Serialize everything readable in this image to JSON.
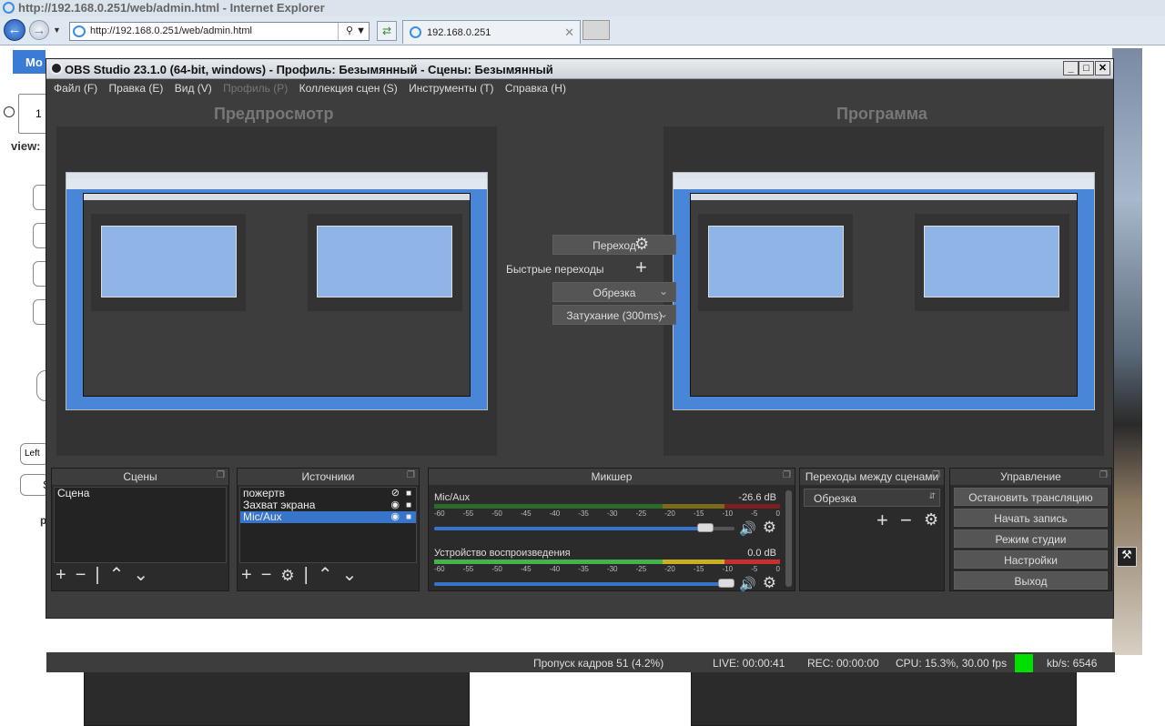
{
  "browser": {
    "window_title": "http://192.168.0.251/web/admin.html - Internet Explorer",
    "address": "http://192.168.0.251/web/admin.html",
    "tab_title": "192.168.0.251"
  },
  "background_page": {
    "tab_label": "Mo",
    "radio_label": "1",
    "view_label": "view:",
    "left_label": "Left",
    "s_label": "S",
    "p_label": "p"
  },
  "obs": {
    "title": "OBS Studio 23.1.0 (64-bit, windows) - Профиль: Безымянный - Сцены: Безымянный",
    "menu": [
      "Файл (F)",
      "Правка (E)",
      "Вид (V)",
      "Профиль (P)",
      "Коллекция сцен (S)",
      "Инструменты (T)",
      "Справка (H)"
    ],
    "preview_label": "Предпросмотр",
    "program_label": "Программа",
    "transition": {
      "button": "Переход",
      "quick_label": "Быстрые переходы",
      "quick_items": [
        "Обрезка",
        "Затухание (300ms)"
      ]
    },
    "docks": {
      "scenes": {
        "title": "Сцены",
        "items": [
          "Сцена"
        ]
      },
      "sources": {
        "title": "Источники",
        "items": [
          "пожертв",
          "Захват экрана",
          "Mic/Aux"
        ]
      },
      "mixer": {
        "title": "Микшер",
        "channels": [
          {
            "name": "Mic/Aux",
            "db": "-26.6 dB",
            "volume": 0.93
          },
          {
            "name": "Устройство воспроизведения",
            "db": "0.0 dB",
            "volume": 1.0
          }
        ],
        "ticks": [
          "-60",
          "-55",
          "-50",
          "-45",
          "-40",
          "-35",
          "-30",
          "-25",
          "-20",
          "-15",
          "-10",
          "-5",
          "0"
        ]
      },
      "transitions": {
        "title": "Переходы между сценами",
        "selected": "Обрезка"
      },
      "controls": {
        "title": "Управление",
        "buttons": [
          "Остановить трансляцию",
          "Начать запись",
          "Режим студии",
          "Настройки",
          "Выход"
        ]
      }
    },
    "status": {
      "dropped": "Пропуск кадров 51 (4.2%)",
      "live": "LIVE: 00:00:41",
      "rec": "REC: 00:00:00",
      "cpu": "CPU: 15.3%, 30.00 fps",
      "kbs": "kb/s: 6546",
      "indicator_color": "#00e000"
    }
  }
}
